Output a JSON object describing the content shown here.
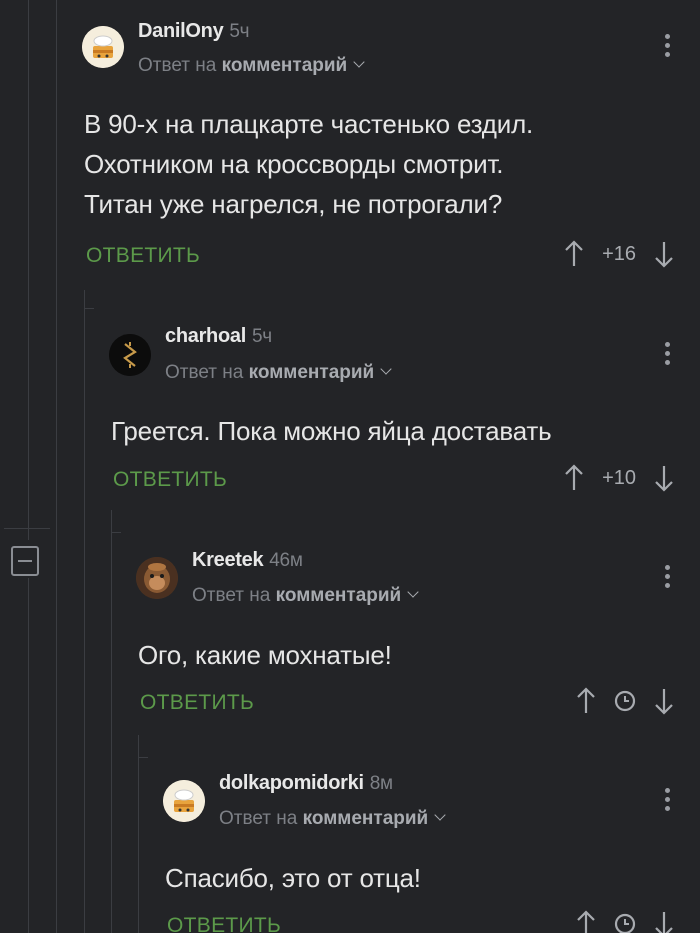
{
  "comments": [
    {
      "author": "DanilOny",
      "time": "5ч",
      "reply_prefix": "Ответ на",
      "reply_target": "комментарий",
      "text": [
        "В 90-х на плацкарте частенько ездил.",
        "Охотником на кроссворды смотрит.",
        "Титан уже нагрелся, не потрогали?"
      ],
      "reply_label": "ОТВЕТИТЬ",
      "score": "+16",
      "avatar_icon": "chef-hat-cake-avatar"
    },
    {
      "author": "charhoal",
      "time": "5ч",
      "reply_prefix": "Ответ на",
      "reply_target": "комментарий",
      "text": [
        "Греется. Пока можно яйца доставать"
      ],
      "reply_label": "ОТВЕТИТЬ",
      "score": "+10",
      "avatar_icon": "rune-symbol-avatar"
    },
    {
      "author": "Kreetek",
      "time": "46м",
      "reply_prefix": "Ответ на",
      "reply_target": "комментарий",
      "text": [
        "Ого, какие мохнатые!"
      ],
      "reply_label": "ОТВЕТИТЬ",
      "score_icon": "clock-icon",
      "avatar_icon": "monkey-photo-avatar"
    },
    {
      "author": "dolkapomidorki",
      "time": "8м",
      "reply_prefix": "Ответ на",
      "reply_target": "комментарий",
      "text": [
        "Спасибо, это от отца!"
      ],
      "reply_label": "ОТВЕТИТЬ",
      "score_icon": "clock-icon",
      "avatar_icon": "chef-hat-cake-avatar"
    }
  ],
  "colors": {
    "background": "#232427",
    "reply_green": "#5c9a4a",
    "muted": "#7d8086"
  }
}
